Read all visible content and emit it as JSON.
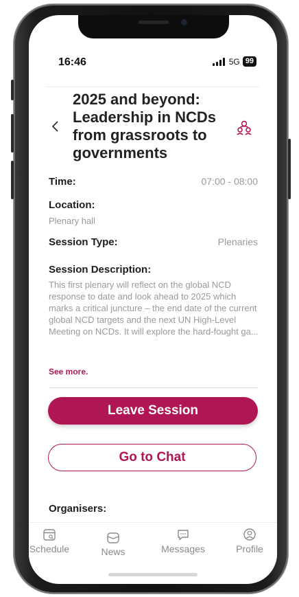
{
  "status_bar": {
    "time": "16:46",
    "network": "5G",
    "battery": "99"
  },
  "header": {
    "title": "2025 and beyond: Leadership in NCDs from grassroots to governments",
    "back_icon": "chevron-left-icon",
    "group_icon": "users-icon"
  },
  "details": {
    "time_label": "Time:",
    "time_value": "07:00 - 08:00",
    "location_label": "Location:",
    "location_value": "Plenary hall",
    "session_type_label": "Session Type:",
    "session_type_value": "Plenaries",
    "description_label": "Session Description:",
    "description_text": "This first plenary will reflect on the global NCD response to date and look ahead to 2025 which marks a critical juncture – the end date of the current global NCD targets and the next UN High-Level Meeting on NCDs. It will explore the hard-fought ga...",
    "see_more": "See more."
  },
  "actions": {
    "leave_label": "Leave Session",
    "chat_label": "Go to Chat"
  },
  "organisers_label": "Organisers:",
  "tabbar": {
    "items": [
      {
        "label": "Schedule",
        "icon": "calendar-search-icon"
      },
      {
        "label": "News",
        "icon": "mailbox-icon"
      },
      {
        "label": "Messages",
        "icon": "chat-bubble-icon"
      },
      {
        "label": "Profile",
        "icon": "user-circle-icon"
      }
    ]
  },
  "colors": {
    "accent": "#b01653",
    "text_dark": "#1e1e1e",
    "text_muted": "#9a9a9a"
  }
}
